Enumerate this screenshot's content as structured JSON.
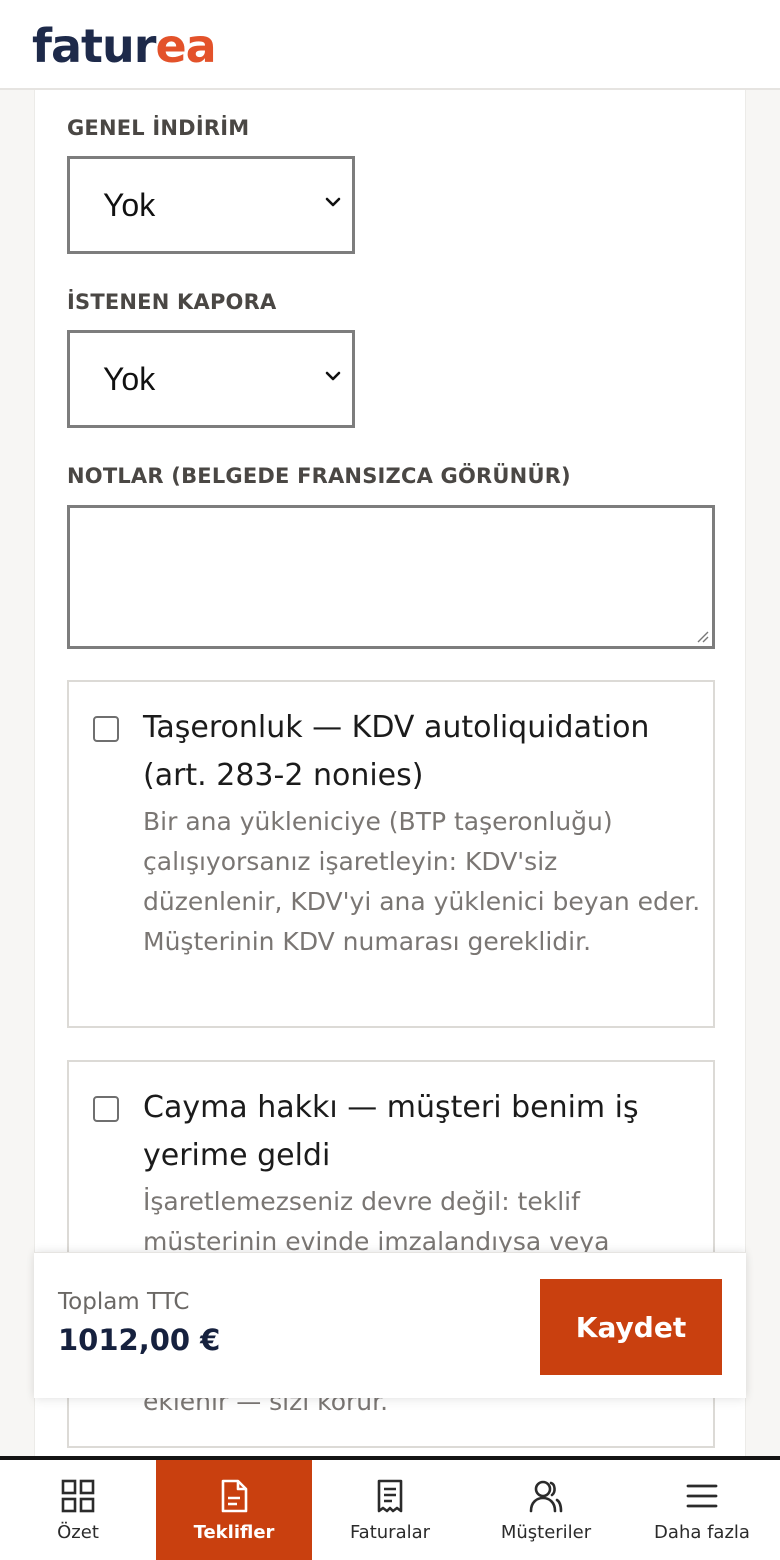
{
  "header": {
    "logo_part1": "fatur",
    "logo_part2": "ea",
    "brand_color": "#e3522a",
    "navy": "#1e2a4a"
  },
  "form": {
    "discount_label": "GENEL İNDİRİM",
    "discount_value": "Yok",
    "deposit_label": "İSTENEN KAPORA",
    "deposit_value": "Yok",
    "notes_label": "NOTLAR (BELGEDE FRANSIZCA GÖRÜNÜR)",
    "notes_value": "",
    "options": [
      {
        "title": "Taşeronluk — KDV autoliquidation (art. 283-2 nonies)",
        "description": "Bir ana yükleniciye (BTP taşeronluğu) çalışıyorsanız işaretleyin: KDV'siz düzenlenir, KDV'yi ana yüklenici beyan eder. Müşterinin KDV numarası gereklidir.",
        "checked": false
      },
      {
        "title": "Cayma hakkı — müşteri benim iş yerime geldi",
        "description": "İşaretlemezseniz devre değil: teklif müsterinin evinde imzalandıysa veya",
        "tail": "eklenir — sizi korur.",
        "checked": false
      }
    ]
  },
  "footer": {
    "total_label": "Toplam TTC",
    "total_value": "1012,00 €",
    "save_label": "Kaydet",
    "accent": "#c9400f"
  },
  "nav": {
    "items": [
      {
        "label": "Özet",
        "icon": "grid-icon"
      },
      {
        "label": "Teklifler",
        "icon": "document-icon",
        "active": true
      },
      {
        "label": "Faturalar",
        "icon": "receipt-icon"
      },
      {
        "label": "Müşteriler",
        "icon": "users-icon"
      },
      {
        "label": "Daha fazla",
        "icon": "menu-icon"
      }
    ]
  }
}
